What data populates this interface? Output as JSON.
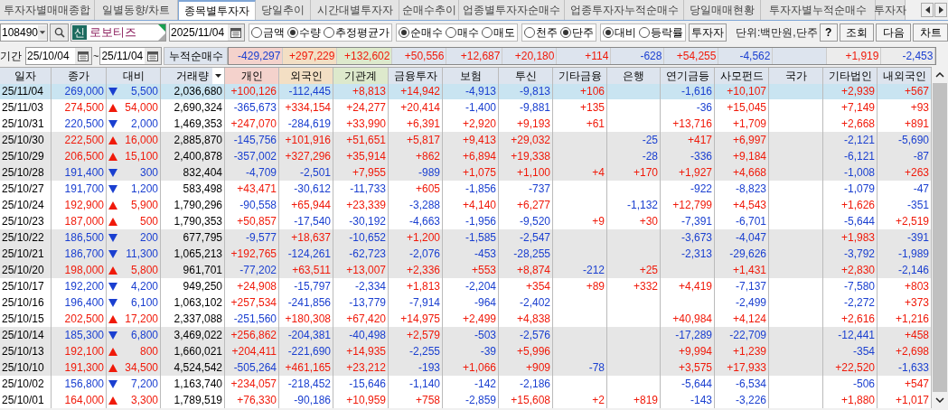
{
  "tabs": [
    {
      "label": "투자자별매매종합",
      "selected": false
    },
    {
      "label": "일별동향/차트",
      "selected": false
    },
    {
      "label": "종목별투자자",
      "selected": true
    },
    {
      "label": "당일추이",
      "selected": false
    },
    {
      "label": "시간대별투자자",
      "selected": false
    },
    {
      "label": "순매수추이",
      "selected": false
    },
    {
      "label": "업종별투자자순매수",
      "selected": false
    },
    {
      "label": "업종투자자누적순매수",
      "selected": false
    },
    {
      "label": "당일매매현황",
      "selected": false
    },
    {
      "label": "투자자별누적순매수",
      "selected": false
    },
    {
      "label": "투자자",
      "selected": false
    }
  ],
  "toolbar": {
    "code": "108490",
    "badge": "신",
    "name": "로보티즈",
    "date": "2025/11/04",
    "radio_groups": [
      [
        {
          "label": "금액",
          "selected": false
        },
        {
          "label": "수량",
          "selected": true
        },
        {
          "label": "추정평균가",
          "selected": false
        }
      ],
      [
        {
          "label": "순매수",
          "selected": true
        },
        {
          "label": "매수",
          "selected": false
        },
        {
          "label": "매도",
          "selected": false
        }
      ],
      [
        {
          "label": "천주",
          "selected": false
        },
        {
          "label": "단주",
          "selected": true
        }
      ],
      [
        {
          "label": "대비",
          "selected": true
        },
        {
          "label": "등락률",
          "selected": false
        }
      ]
    ],
    "investor_button": "투자자",
    "unit": "단위:백만원,단주",
    "buttons": [
      "?",
      "조회",
      "다음",
      "차트"
    ]
  },
  "period": {
    "label": "기간",
    "from": "25/10/04",
    "separator": "~",
    "to": "25/11/04",
    "total_label": "누적순매수",
    "totals": {
      "individual": "-429,297",
      "foreign": "+297,229",
      "institution": "+132,602",
      "financial": "+50,556",
      "insurance": "+12,687",
      "trust": "+20,180",
      "other_finance": "+114",
      "bank": "-628",
      "pension": "+54,255",
      "private_equity": "-4,562",
      "other_corp": "+1,919",
      "domestic_foreign": "-2,453"
    }
  },
  "columns": [
    "일자",
    "종가",
    "대비",
    "거래량",
    "개인",
    "외국인",
    "기관계",
    "금융투자",
    "보험",
    "투신",
    "기타금융",
    "은행",
    "연기금등",
    "사모펀드",
    "국가",
    "기타법인",
    "내외국인"
  ],
  "rows": [
    {
      "date": "25/11/04",
      "close": "269,000",
      "kind": "down",
      "change": "5,500",
      "volume": "2,036,680",
      "values": {
        "individual": "+100,126",
        "foreign": "-112,445",
        "institution": "+8,813",
        "financial": "+14,942",
        "insurance": "-4,913",
        "trust": "-9,813",
        "other_finance": "+106",
        "pension": "-1,616",
        "private_equity": "+10,107",
        "other_corp": "+2,939",
        "domestic_foreign": "+567"
      },
      "shaded": false,
      "selected": true
    },
    {
      "date": "25/11/03",
      "close": "274,500",
      "kind": "up",
      "change": "54,000",
      "volume": "2,690,324",
      "values": {
        "individual": "-365,673",
        "foreign": "+334,154",
        "institution": "+24,277",
        "financial": "+20,414",
        "insurance": "-1,400",
        "trust": "-9,881",
        "other_finance": "+135",
        "pension": "-36",
        "private_equity": "+15,045",
        "other_corp": "+7,149",
        "domestic_foreign": "+93"
      },
      "shaded": false,
      "selected": false
    },
    {
      "date": "25/10/31",
      "close": "220,500",
      "kind": "down",
      "change": "2,000",
      "volume": "1,469,353",
      "values": {
        "individual": "+247,070",
        "foreign": "-284,619",
        "institution": "+33,990",
        "financial": "+6,391",
        "insurance": "+2,920",
        "trust": "+9,193",
        "other_finance": "+61",
        "pension": "+13,716",
        "private_equity": "+1,709",
        "other_corp": "+2,668",
        "domestic_foreign": "+891"
      },
      "shaded": false,
      "selected": false
    },
    {
      "date": "25/10/30",
      "close": "222,500",
      "kind": "up",
      "change": "16,000",
      "volume": "2,885,870",
      "values": {
        "individual": "-145,756",
        "foreign": "+101,916",
        "institution": "+51,651",
        "financial": "+5,817",
        "insurance": "+9,413",
        "trust": "+29,032",
        "bank": "-25",
        "pension": "+417",
        "private_equity": "+6,997",
        "other_corp": "-2,121",
        "domestic_foreign": "-5,690"
      },
      "shaded": true,
      "selected": false
    },
    {
      "date": "25/10/29",
      "close": "206,500",
      "kind": "up",
      "change": "15,100",
      "volume": "2,400,878",
      "values": {
        "individual": "-357,002",
        "foreign": "+327,296",
        "institution": "+35,914",
        "financial": "+862",
        "insurance": "+6,894",
        "trust": "+19,338",
        "bank": "-28",
        "pension": "-336",
        "private_equity": "+9,184",
        "other_corp": "-6,121",
        "domestic_foreign": "-87"
      },
      "shaded": true,
      "selected": false
    },
    {
      "date": "25/10/28",
      "close": "191,400",
      "kind": "down",
      "change": "300",
      "volume": "832,404",
      "values": {
        "individual": "-4,709",
        "foreign": "-2,501",
        "institution": "+7,955",
        "financial": "-989",
        "insurance": "+1,075",
        "trust": "+1,100",
        "other_finance": "+4",
        "bank": "+170",
        "pension": "+1,927",
        "private_equity": "+4,668",
        "other_corp": "-1,008",
        "domestic_foreign": "+263"
      },
      "shaded": true,
      "selected": false
    },
    {
      "date": "25/10/27",
      "close": "191,700",
      "kind": "down",
      "change": "1,200",
      "volume": "583,498",
      "values": {
        "individual": "+43,471",
        "foreign": "-30,612",
        "institution": "-11,733",
        "financial": "+605",
        "insurance": "-1,856",
        "trust": "-737",
        "pension": "-922",
        "private_equity": "-8,823",
        "other_corp": "-1,079",
        "domestic_foreign": "-47"
      },
      "shaded": false,
      "selected": false
    },
    {
      "date": "25/10/24",
      "close": "192,900",
      "kind": "up",
      "change": "5,900",
      "volume": "1,790,296",
      "values": {
        "individual": "-90,558",
        "foreign": "+65,944",
        "institution": "+23,339",
        "financial": "-3,288",
        "insurance": "+4,140",
        "trust": "+6,277",
        "bank": "-1,132",
        "pension": "+12,799",
        "private_equity": "+4,543",
        "other_corp": "+1,626",
        "domestic_foreign": "-351"
      },
      "shaded": false,
      "selected": false
    },
    {
      "date": "25/10/23",
      "close": "187,000",
      "kind": "up",
      "change": "500",
      "volume": "1,790,353",
      "values": {
        "individual": "+50,857",
        "foreign": "-17,540",
        "institution": "-30,192",
        "financial": "-4,663",
        "insurance": "-1,956",
        "trust": "-9,520",
        "other_finance": "+9",
        "bank": "+30",
        "pension": "-7,391",
        "private_equity": "-6,701",
        "other_corp": "-5,644",
        "domestic_foreign": "+2,519"
      },
      "shaded": false,
      "selected": false
    },
    {
      "date": "25/10/22",
      "close": "186,500",
      "kind": "down",
      "change": "200",
      "volume": "677,795",
      "values": {
        "individual": "-9,577",
        "foreign": "+18,637",
        "institution": "-10,652",
        "financial": "+1,200",
        "insurance": "-1,585",
        "trust": "-2,547",
        "pension": "-3,673",
        "private_equity": "-4,047",
        "other_corp": "+1,983",
        "domestic_foreign": "-391"
      },
      "shaded": true,
      "selected": false
    },
    {
      "date": "25/10/21",
      "close": "186,700",
      "kind": "down",
      "change": "11,300",
      "volume": "1,065,213",
      "values": {
        "individual": "+192,765",
        "foreign": "-124,261",
        "institution": "-62,723",
        "financial": "-2,076",
        "insurance": "-453",
        "trust": "-28,255",
        "pension": "-2,313",
        "private_equity": "-29,626",
        "other_corp": "-3,792",
        "domestic_foreign": "-1,989"
      },
      "shaded": true,
      "selected": false
    },
    {
      "date": "25/10/20",
      "close": "198,000",
      "kind": "up",
      "change": "5,800",
      "volume": "961,701",
      "values": {
        "individual": "-77,202",
        "foreign": "+63,511",
        "institution": "+13,007",
        "financial": "+2,336",
        "insurance": "+553",
        "trust": "+8,874",
        "other_finance": "-212",
        "bank": "+25",
        "private_equity": "+1,431",
        "other_corp": "+2,830",
        "domestic_foreign": "-2,146"
      },
      "shaded": true,
      "selected": false
    },
    {
      "date": "25/10/17",
      "close": "192,200",
      "kind": "down",
      "change": "4,200",
      "volume": "949,250",
      "values": {
        "individual": "+24,908",
        "foreign": "-15,797",
        "institution": "-2,334",
        "financial": "+1,813",
        "insurance": "-2,204",
        "trust": "+354",
        "other_finance": "+89",
        "bank": "+332",
        "pension": "+4,419",
        "private_equity": "-7,137",
        "other_corp": "-7,580",
        "domestic_foreign": "+803"
      },
      "shaded": false,
      "selected": false
    },
    {
      "date": "25/10/16",
      "close": "196,400",
      "kind": "down",
      "change": "6,100",
      "volume": "1,063,102",
      "values": {
        "individual": "+257,534",
        "foreign": "-241,856",
        "institution": "-13,779",
        "financial": "-7,914",
        "insurance": "-964",
        "trust": "-2,402",
        "private_equity": "-2,499",
        "other_corp": "-2,272",
        "domestic_foreign": "+373"
      },
      "shaded": false,
      "selected": false
    },
    {
      "date": "25/10/15",
      "close": "202,500",
      "kind": "up",
      "change": "17,200",
      "volume": "2,337,088",
      "values": {
        "individual": "-251,560",
        "foreign": "+180,308",
        "institution": "+67,420",
        "financial": "+14,975",
        "insurance": "+2,499",
        "trust": "+4,838",
        "pension": "+40,984",
        "private_equity": "+4,124",
        "other_corp": "+2,616",
        "domestic_foreign": "+1,216"
      },
      "shaded": false,
      "selected": false
    },
    {
      "date": "25/10/14",
      "close": "185,300",
      "kind": "down",
      "change": "6,800",
      "volume": "3,469,022",
      "values": {
        "individual": "+256,862",
        "foreign": "-204,381",
        "institution": "-40,498",
        "financial": "+2,579",
        "insurance": "-503",
        "trust": "-2,576",
        "pension": "-17,289",
        "private_equity": "-22,709",
        "other_corp": "-12,441",
        "domestic_foreign": "+458"
      },
      "shaded": true,
      "selected": false
    },
    {
      "date": "25/10/13",
      "close": "192,100",
      "kind": "up",
      "change": "800",
      "volume": "1,660,021",
      "values": {
        "individual": "+204,411",
        "foreign": "-221,690",
        "institution": "+14,935",
        "financial": "-2,255",
        "insurance": "-39",
        "trust": "+5,996",
        "pension": "+9,994",
        "private_equity": "+1,239",
        "other_corp": "-354",
        "domestic_foreign": "+2,698"
      },
      "shaded": true,
      "selected": false
    },
    {
      "date": "25/10/10",
      "close": "191,300",
      "kind": "up",
      "change": "34,500",
      "volume": "4,524,542",
      "values": {
        "individual": "-505,264",
        "foreign": "+461,165",
        "institution": "+23,212",
        "financial": "-193",
        "insurance": "+1,066",
        "trust": "+909",
        "other_finance": "-78",
        "pension": "+3,575",
        "private_equity": "+17,933",
        "other_corp": "+22,520",
        "domestic_foreign": "-1,633"
      },
      "shaded": true,
      "selected": false
    },
    {
      "date": "25/10/02",
      "close": "156,800",
      "kind": "down",
      "change": "7,200",
      "volume": "1,163,740",
      "values": {
        "individual": "+234,057",
        "foreign": "-218,452",
        "institution": "-15,646",
        "financial": "-1,140",
        "insurance": "-142",
        "trust": "-2,186",
        "pension": "-5,644",
        "private_equity": "-6,534",
        "other_corp": "-506",
        "domestic_foreign": "+547"
      },
      "shaded": false,
      "selected": false
    },
    {
      "date": "25/10/01",
      "close": "164,000",
      "kind": "up",
      "change": "3,300",
      "volume": "1,789,519",
      "values": {
        "individual": "+76,330",
        "foreign": "-90,186",
        "institution": "+10,959",
        "financial": "+758",
        "insurance": "-2,859",
        "trust": "+15,608",
        "other_finance": "+2",
        "bank": "+819",
        "pension": "-143",
        "private_equity": "-3,226",
        "other_corp": "+1,880",
        "domestic_foreign": "+1,017"
      },
      "shaded": false,
      "selected": false
    }
  ]
}
